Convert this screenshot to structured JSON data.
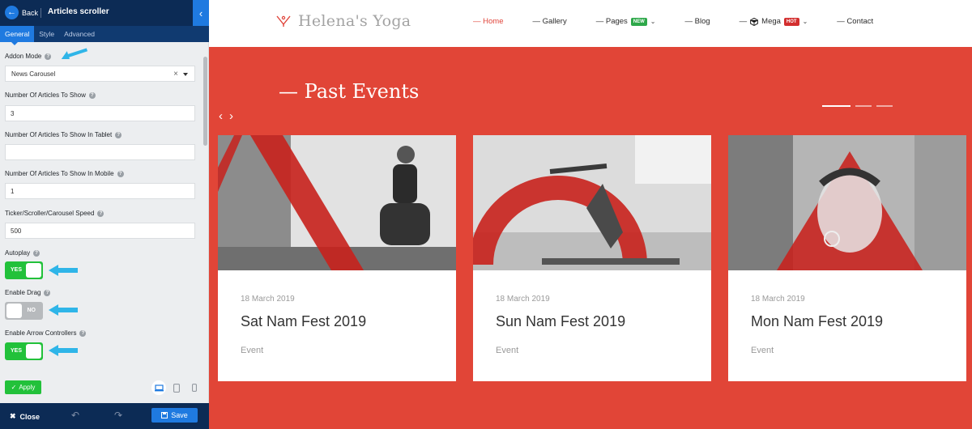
{
  "panel": {
    "back_label": "Back",
    "title": "Articles scroller",
    "tabs": [
      "General",
      "Style",
      "Advanced"
    ],
    "fields": {
      "addon_mode": {
        "label": "Addon Mode",
        "value": "News Carousel"
      },
      "articles_to_show": {
        "label": "Number Of Articles To Show",
        "value": "3"
      },
      "articles_tablet": {
        "label": "Number Of Articles To Show In Tablet",
        "value": ""
      },
      "articles_mobile": {
        "label": "Number Of Articles To Show In Mobile",
        "value": "1"
      },
      "speed": {
        "label": "Ticker/Scroller/Carousel Speed",
        "value": "500"
      },
      "autoplay": {
        "label": "Autoplay",
        "state": "YES"
      },
      "enable_drag": {
        "label": "Enable Drag",
        "state": "NO"
      },
      "arrow_controllers": {
        "label": "Enable Arrow Controllers",
        "state": "YES"
      }
    },
    "apply_label": "Apply",
    "close_label": "Close",
    "save_label": "Save",
    "colors": {
      "header": "#0c2b55",
      "accent": "#1f7ae0",
      "toggle_on": "#22c13a",
      "arrow": "#2fb5e8"
    }
  },
  "site": {
    "logo_text": "Helena's Yoga",
    "nav": [
      {
        "label": "— Home",
        "active": true
      },
      {
        "label": "— Gallery"
      },
      {
        "label": "— Pages",
        "badge": "NEW",
        "badge_color": "#2ea84a"
      },
      {
        "label": "— Blog"
      },
      {
        "label": "— ",
        "icon": "mega-icon",
        "text": "Mega",
        "badge": "HOT",
        "badge_color": "#d32f2f"
      },
      {
        "label": "— Contact"
      }
    ],
    "section_title": "— Past Events",
    "hero_color": "#e14537",
    "cards": [
      {
        "date": "18 March 2019",
        "title": "Sat Nam Fest 2019",
        "category": "Event"
      },
      {
        "date": "18 March 2019",
        "title": "Sun Nam Fest 2019",
        "category": "Event"
      },
      {
        "date": "18 March 2019",
        "title": "Mon Nam Fest 2019",
        "category": "Event"
      }
    ]
  }
}
